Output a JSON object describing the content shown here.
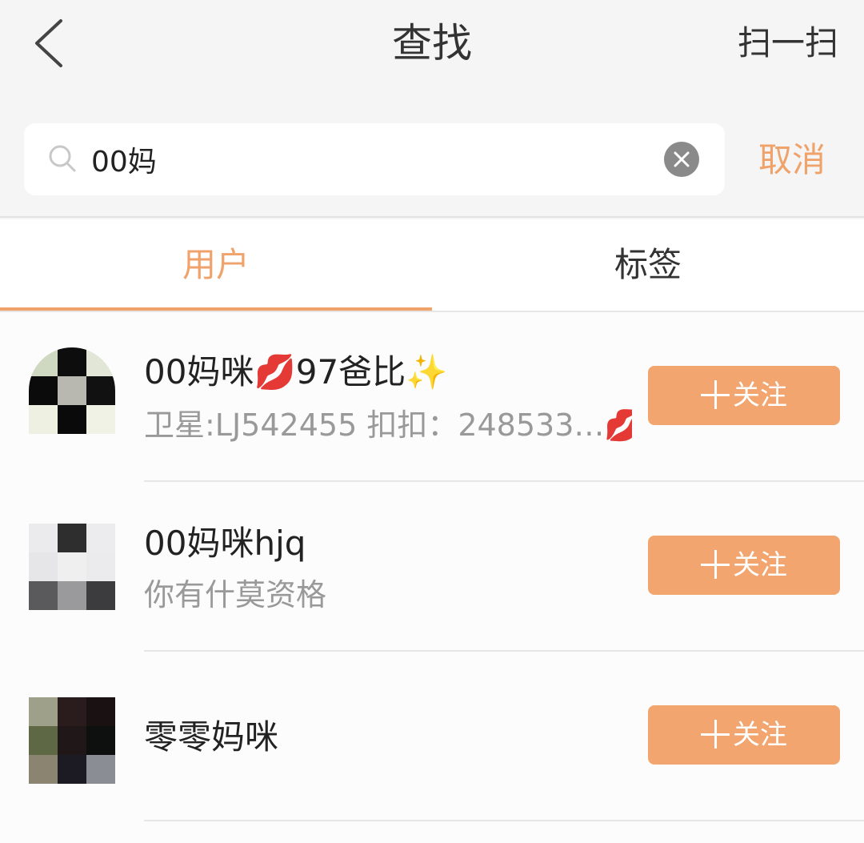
{
  "header": {
    "title": "查找",
    "scan_label": "扫一扫",
    "back_icon": "chevron-left-icon"
  },
  "search": {
    "value": "00妈",
    "cancel_label": "取消",
    "search_icon": "search-icon",
    "clear_icon": "clear-icon"
  },
  "tabs": [
    {
      "label": "用户",
      "active": true
    },
    {
      "label": "标签",
      "active": false
    }
  ],
  "colors": {
    "accent": "#f0a26b",
    "follow_button": "#f2a56f",
    "background": "#f5f5f5"
  },
  "users": [
    {
      "name": "00妈咪💋97爸比✨",
      "bio": "卫星:LJ542455 扣扣：248533…💋",
      "follow_label": "关注"
    },
    {
      "name": "00妈咪hjq",
      "bio": "你有什莫资格",
      "follow_label": "关注"
    },
    {
      "name": "零零妈咪",
      "bio": "",
      "follow_label": "关注"
    }
  ]
}
